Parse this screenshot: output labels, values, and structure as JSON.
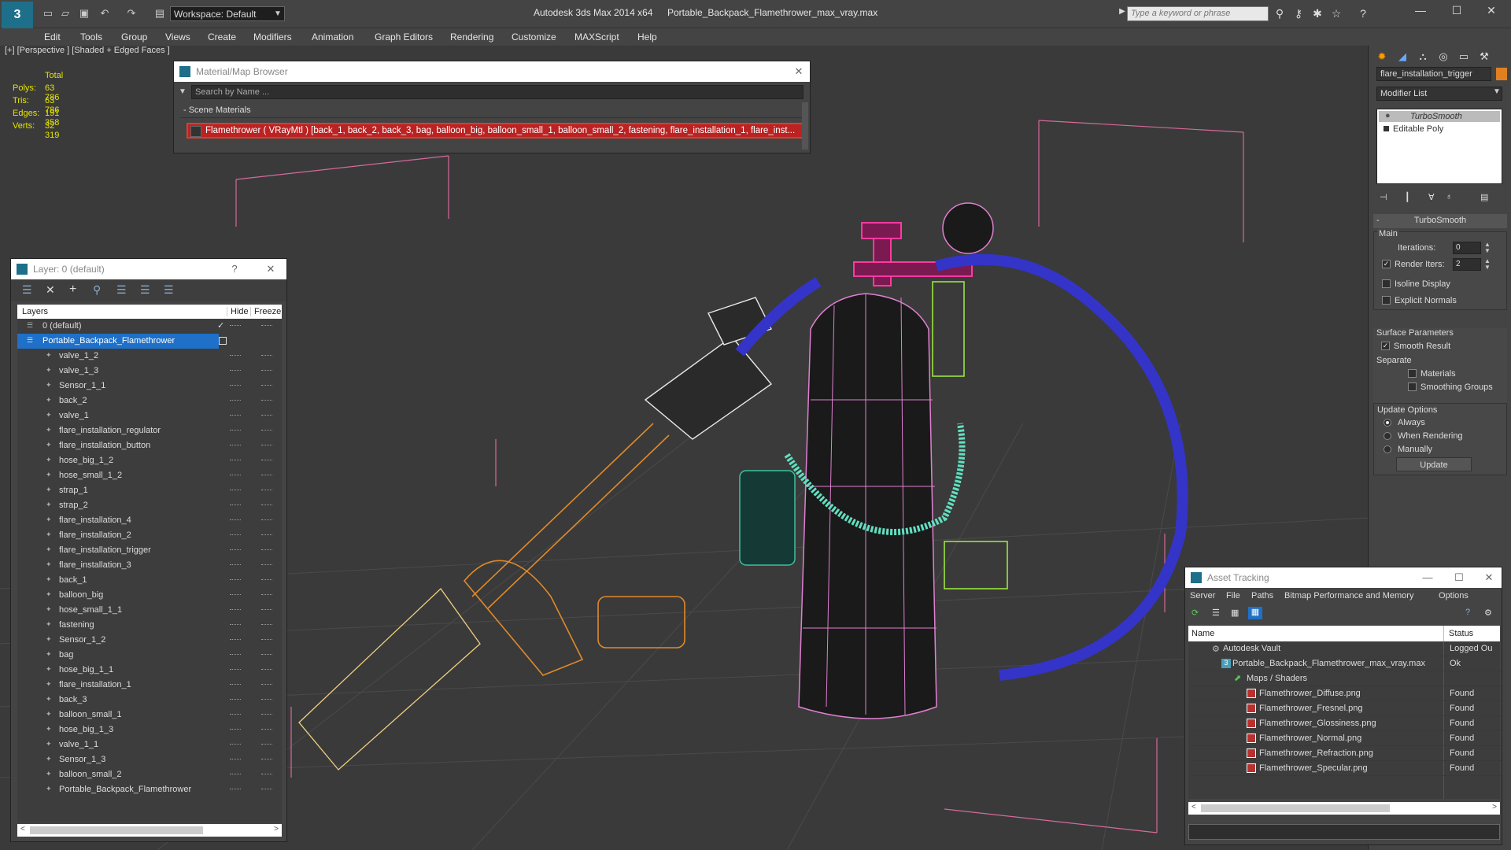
{
  "titlebar": {
    "workspace": "Workspace: Default",
    "app_title": "Autodesk 3ds Max  2014 x64",
    "file_title": "Portable_Backpack_Flamethrower_max_vray.max",
    "search_placeholder": "Type a keyword or phrase"
  },
  "menu": [
    "Edit",
    "Tools",
    "Group",
    "Views",
    "Create",
    "Modifiers",
    "Animation",
    "Graph Editors",
    "Rendering",
    "Customize",
    "MAXScript",
    "Help"
  ],
  "viewport": {
    "label": "[+] [Perspective ] [Shaded + Edged Faces ]",
    "stats": {
      "header": "Total",
      "rows": [
        {
          "k": "Polys:",
          "v": "63 786"
        },
        {
          "k": "Tris:",
          "v": "63 786"
        },
        {
          "k": "Edges:",
          "v": "191 358"
        },
        {
          "k": "Verts:",
          "v": "32 319"
        }
      ]
    }
  },
  "material_browser": {
    "title": "Material/Map Browser",
    "search_placeholder": "Search by Name ...",
    "section": "- Scene Materials",
    "item": "Flamethrower ( VRayMtl ) [back_1, back_2, back_3, bag, balloon_big, balloon_small_1, balloon_small_2, fastening, flare_installation_1, flare_inst..."
  },
  "layer_panel": {
    "title": "Layer: 0 (default)",
    "help": "?",
    "col_layers": "Layers",
    "col_hide": "Hide",
    "col_freeze": "Freeze",
    "default_layer": "0 (default)",
    "selected_layer": "Portable_Backpack_Flamethrower",
    "items": [
      "valve_1_2",
      "valve_1_3",
      "Sensor_1_1",
      "back_2",
      "valve_1",
      "flare_installation_regulator",
      "flare_installation_button",
      "hose_big_1_2",
      "hose_small_1_2",
      "strap_1",
      "strap_2",
      "flare_installation_4",
      "flare_installation_2",
      "flare_installation_trigger",
      "flare_installation_3",
      "back_1",
      "balloon_big",
      "hose_small_1_1",
      "fastening",
      "Sensor_1_2",
      "bag",
      "hose_big_1_1",
      "flare_installation_1",
      "back_3",
      "balloon_small_1",
      "hose_big_1_3",
      "valve_1_1",
      "Sensor_1_3",
      "balloon_small_2",
      "Portable_Backpack_Flamethrower"
    ]
  },
  "modifier_panel": {
    "object_name": "flare_installation_trigger",
    "modifier_list": "Modifier List",
    "stack": [
      "TurboSmooth",
      "Editable Poly"
    ],
    "rollout_title": "TurboSmooth",
    "main": "Main",
    "iterations_label": "Iterations:",
    "iterations_value": "0",
    "render_iters_label": "Render Iters:",
    "render_iters_value": "2",
    "isoline": "Isoline Display",
    "explicit": "Explicit Normals",
    "surface_params": "Surface Parameters",
    "smooth_result": "Smooth Result",
    "separate": "Separate",
    "materials": "Materials",
    "smoothing_groups": "Smoothing Groups",
    "update_options": "Update Options",
    "always": "Always",
    "when_rendering": "When Rendering",
    "manually": "Manually",
    "update_button": "Update"
  },
  "asset_tracking": {
    "title": "Asset Tracking",
    "menu": [
      "Server",
      "File",
      "Paths",
      "Bitmap Performance and Memory",
      "Options"
    ],
    "col_name": "Name",
    "col_status": "Status",
    "rows": [
      {
        "name": "Autodesk Vault",
        "status": "Logged Ou"
      },
      {
        "name": "Portable_Backpack_Flamethrower_max_vray.max",
        "status": "Ok"
      },
      {
        "name": "Maps / Shaders",
        "status": ""
      },
      {
        "name": "Flamethrower_Diffuse.png",
        "status": "Found"
      },
      {
        "name": "Flamethrower_Fresnel.png",
        "status": "Found"
      },
      {
        "name": "Flamethrower_Glossiness.png",
        "status": "Found"
      },
      {
        "name": "Flamethrower_Normal.png",
        "status": "Found"
      },
      {
        "name": "Flamethrower_Refraction.png",
        "status": "Found"
      },
      {
        "name": "Flamethrower_Specular.png",
        "status": "Found"
      }
    ]
  }
}
